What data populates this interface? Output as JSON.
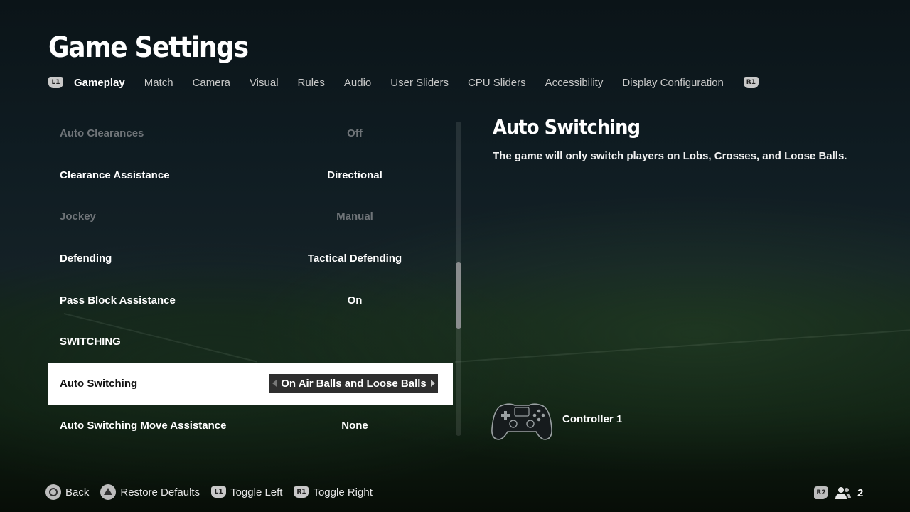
{
  "header": {
    "title": "Game Settings",
    "left_bumper": "L1",
    "right_bumper": "R1",
    "tabs": [
      {
        "label": "Gameplay",
        "active": true
      },
      {
        "label": "Match"
      },
      {
        "label": "Camera"
      },
      {
        "label": "Visual"
      },
      {
        "label": "Rules"
      },
      {
        "label": "Audio"
      },
      {
        "label": "User Sliders"
      },
      {
        "label": "CPU Sliders"
      },
      {
        "label": "Accessibility"
      },
      {
        "label": "Display Configuration"
      }
    ]
  },
  "settings": [
    {
      "label": "Auto Clearances",
      "value": "Off",
      "state": "disabled"
    },
    {
      "label": "Clearance Assistance",
      "value": "Directional"
    },
    {
      "label": "Jockey",
      "value": "Manual",
      "state": "disabled"
    },
    {
      "label": "Defending",
      "value": "Tactical Defending"
    },
    {
      "label": "Pass Block Assistance",
      "value": "On"
    },
    {
      "label": "SWITCHING",
      "value": "",
      "state": "section-header"
    },
    {
      "label": "Auto Switching",
      "value": "On Air Balls and Loose Balls",
      "state": "selected"
    },
    {
      "label": "Auto Switching Move Assistance",
      "value": "None"
    }
  ],
  "detail": {
    "title": "Auto Switching",
    "description": "The game will only switch players on Lobs, Crosses, and Loose Balls."
  },
  "controller": {
    "icon": "gamepad-icon",
    "label": "Controller 1"
  },
  "footer": {
    "back": {
      "button": "circle",
      "label": "Back"
    },
    "restore": {
      "button": "triangle",
      "label": "Restore Defaults"
    },
    "toggle_left": {
      "button": "L1",
      "label": "Toggle Left"
    },
    "toggle_right": {
      "button": "R1",
      "label": "Toggle Right"
    },
    "r2": "R2",
    "users_icon": "users-icon",
    "user_count": "2"
  },
  "scroll": {
    "position_fraction": 0.45,
    "visible_fraction": 0.21
  },
  "colors": {
    "selected_row_bg": "#ffffff",
    "selector_bg": "#2e2e2e",
    "dim_text": "#6f7478"
  }
}
